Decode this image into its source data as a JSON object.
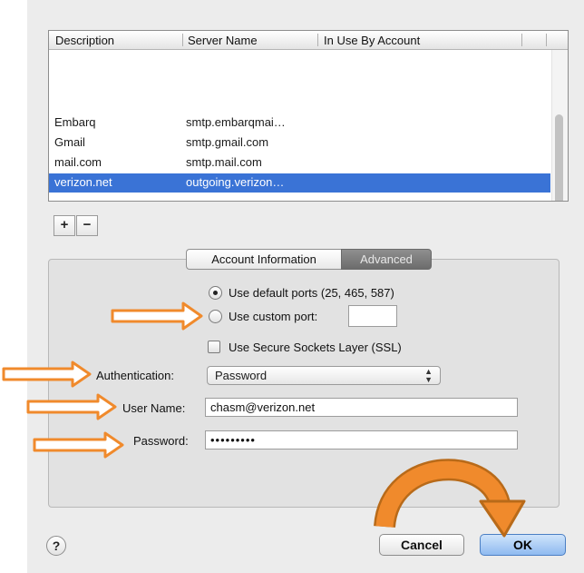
{
  "table": {
    "columns": [
      "Description",
      "Server Name",
      "In Use By Account"
    ],
    "rows": [
      {
        "description": "Embarq",
        "server": "smtp.embarqmai…",
        "selected": false
      },
      {
        "description": "Gmail",
        "server": "smtp.gmail.com",
        "selected": false
      },
      {
        "description": "mail.com",
        "server": "smtp.mail.com",
        "selected": false
      },
      {
        "description": "verizon.net",
        "server": "outgoing.verizon…",
        "selected": true
      }
    ]
  },
  "list_controls": {
    "add_label": "+",
    "remove_label": "−"
  },
  "tabs": [
    {
      "label": "Account Information",
      "active": false
    },
    {
      "label": "Advanced",
      "active": true
    }
  ],
  "ports": {
    "default_label": "Use default ports (25, 465, 587)",
    "custom_label": "Use custom port:",
    "custom_value": "",
    "selected": "default"
  },
  "ssl": {
    "label": "Use Secure Sockets Layer (SSL)",
    "checked": false
  },
  "authentication": {
    "label": "Authentication:",
    "value": "Password"
  },
  "user_name": {
    "label": "User Name:",
    "value": "chasm@verizon.net"
  },
  "password": {
    "label": "Password:",
    "value": "•••••••••"
  },
  "buttons": {
    "help": "?",
    "cancel": "Cancel",
    "ok": "OK"
  },
  "colors": {
    "selection": "#3a73d6",
    "arrow": "#f08a2c",
    "ok_button": "#8fbaf0"
  },
  "annotations": {
    "arrow_count": 5,
    "curved_arrow_target": "ok-button"
  }
}
